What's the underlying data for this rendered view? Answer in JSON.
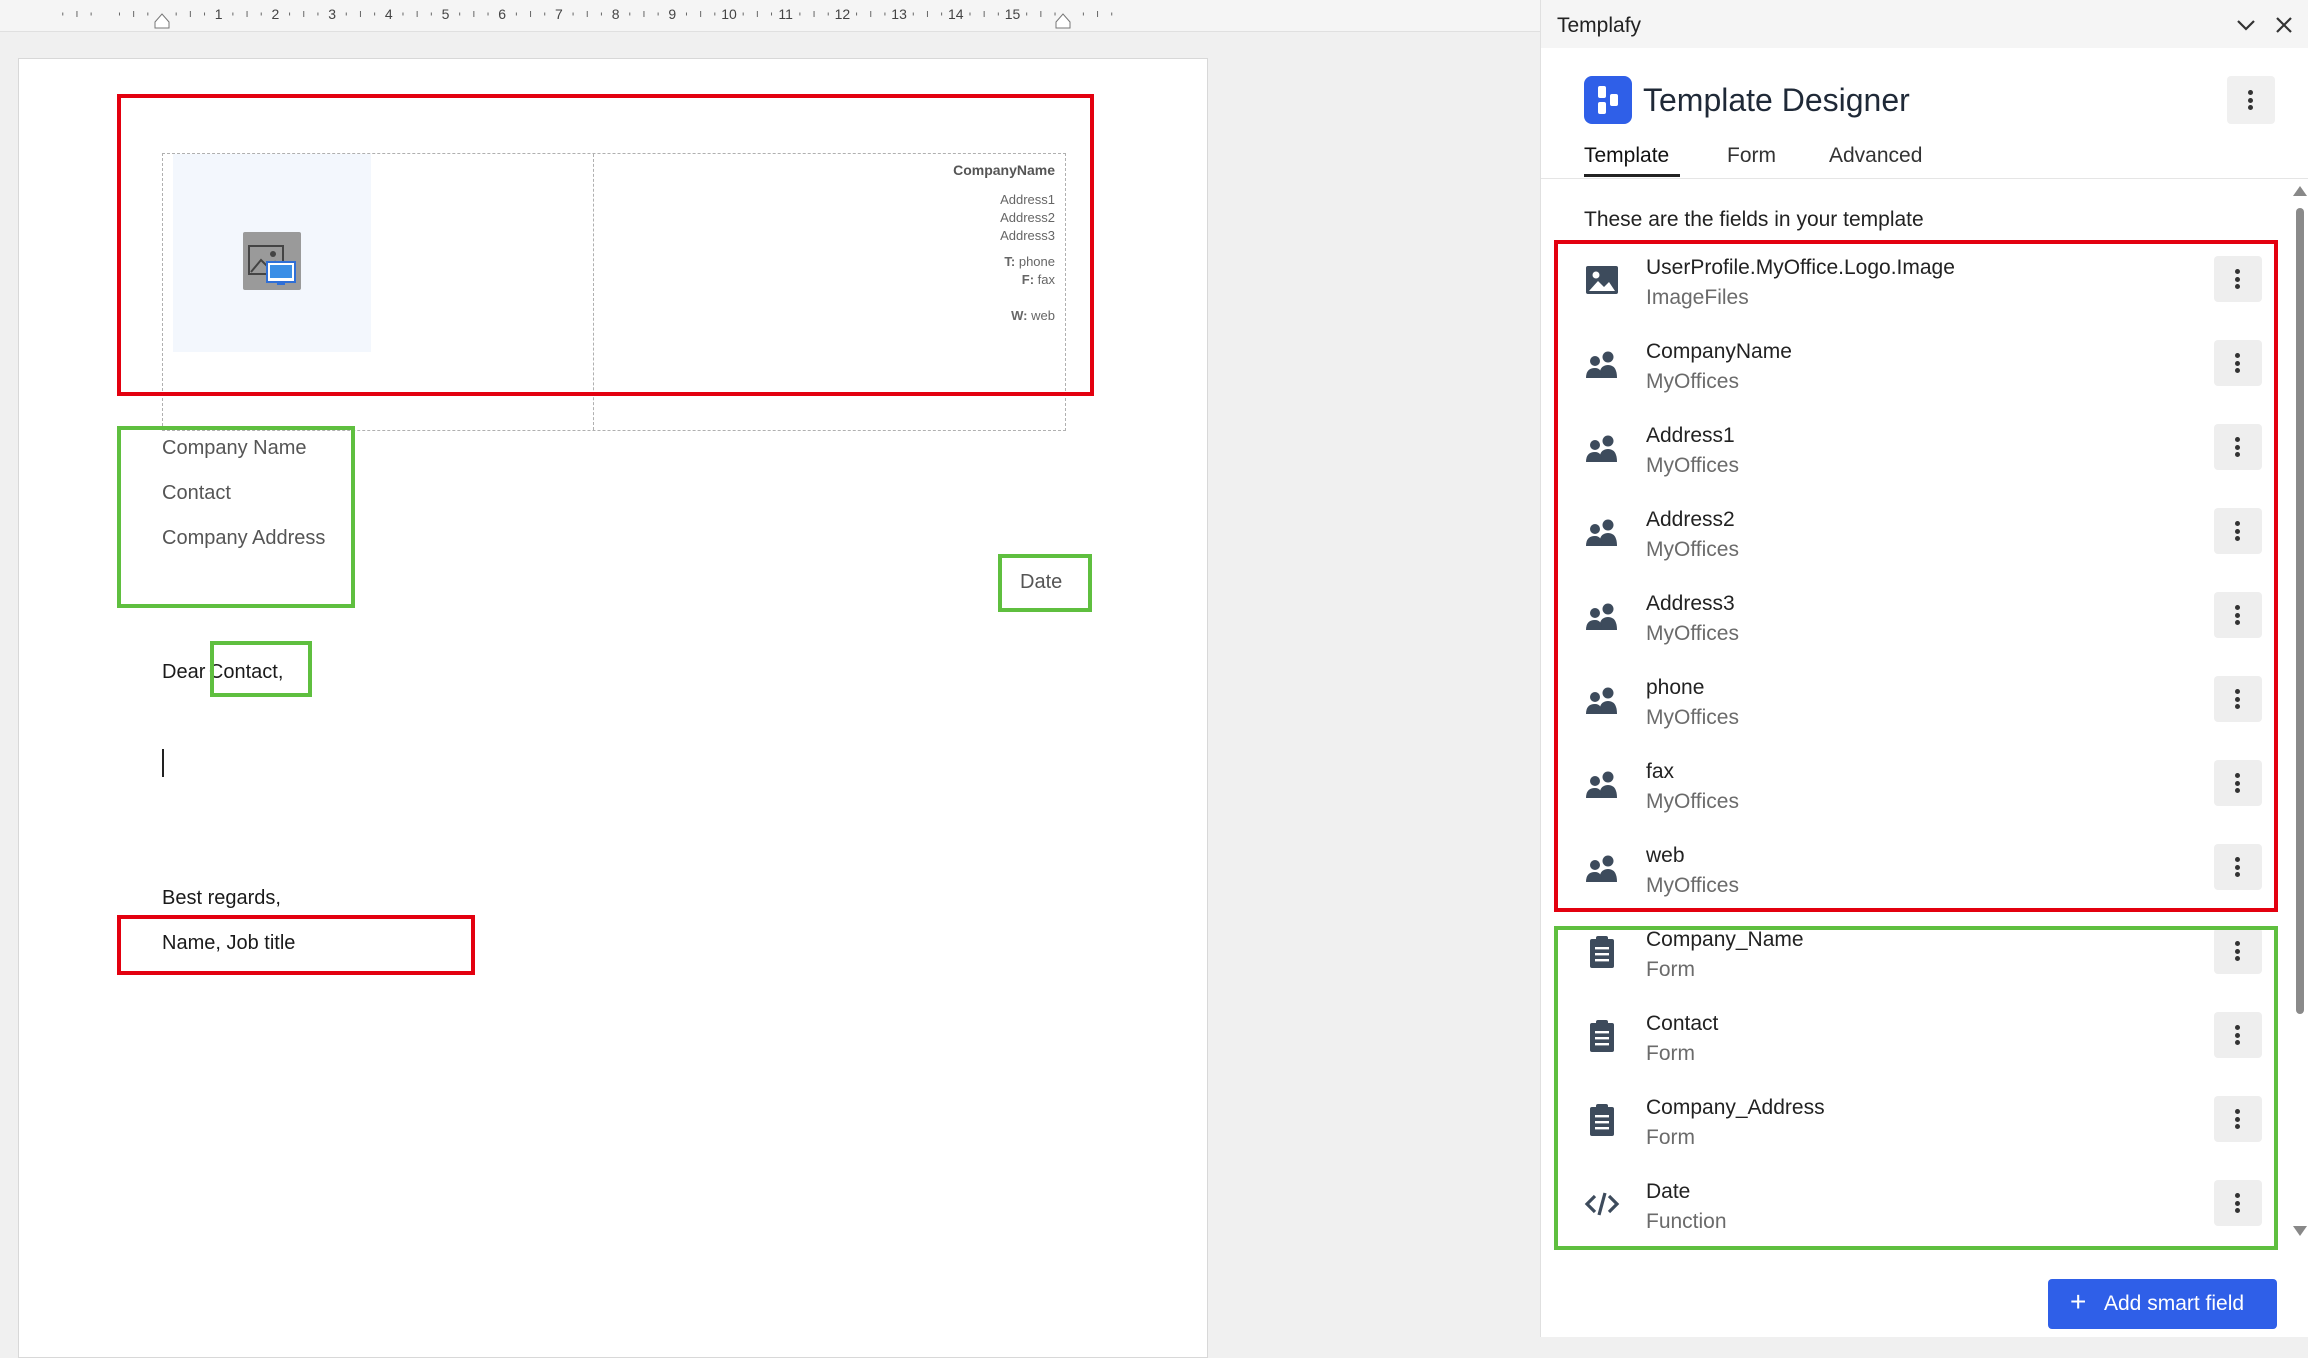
{
  "ruler": {
    "numbers": [
      "1",
      "2",
      "3",
      "4",
      "5",
      "6",
      "7",
      "8",
      "9",
      "10",
      "11",
      "12",
      "13",
      "14",
      "15"
    ]
  },
  "document": {
    "header": {
      "company_name": "CompanyName",
      "address1": "Address1",
      "address2": "Address2",
      "address3": "Address3",
      "phone_label": "T:",
      "phone_value": "phone",
      "fax_label": "F:",
      "fax_value": "fax",
      "web_label": "W:",
      "web_value": "web"
    },
    "recipient": {
      "company_name": "Company Name",
      "contact": "Contact",
      "company_address": "Company Address"
    },
    "date": "Date",
    "salutation_prefix": "Dear",
    "salutation_contact": "Contact,",
    "closing": "Best regards,",
    "signature": "Name, Job title"
  },
  "panel": {
    "title": "Templafy",
    "app_name": "Template Designer",
    "tabs": [
      {
        "label": "Template",
        "active": true
      },
      {
        "label": "Form",
        "active": false
      },
      {
        "label": "Advanced",
        "active": false
      }
    ],
    "section_heading": "These are the fields in your template",
    "fields": [
      {
        "name": "UserProfile.MyOffice.Logo.Image",
        "source": "ImageFiles",
        "icon": "image-icon"
      },
      {
        "name": "CompanyName",
        "source": "MyOffices",
        "icon": "people-icon"
      },
      {
        "name": "Address1",
        "source": "MyOffices",
        "icon": "people-icon"
      },
      {
        "name": "Address2",
        "source": "MyOffices",
        "icon": "people-icon"
      },
      {
        "name": "Address3",
        "source": "MyOffices",
        "icon": "people-icon"
      },
      {
        "name": "phone",
        "source": "MyOffices",
        "icon": "people-icon"
      },
      {
        "name": "fax",
        "source": "MyOffices",
        "icon": "people-icon"
      },
      {
        "name": "web",
        "source": "MyOffices",
        "icon": "people-icon"
      },
      {
        "name": "Company_Name",
        "source": "Form",
        "icon": "clipboard-icon"
      },
      {
        "name": "Contact",
        "source": "Form",
        "icon": "clipboard-icon"
      },
      {
        "name": "Company_Address",
        "source": "Form",
        "icon": "clipboard-icon"
      },
      {
        "name": "Date",
        "source": "Function",
        "icon": "code-icon"
      }
    ],
    "add_button_label": "Add smart field"
  },
  "colors": {
    "highlight_red": "#e3000f",
    "highlight_green": "#5fbf3f",
    "accent_blue": "#2f5fe8",
    "icon_slate": "#3d4b5c"
  }
}
